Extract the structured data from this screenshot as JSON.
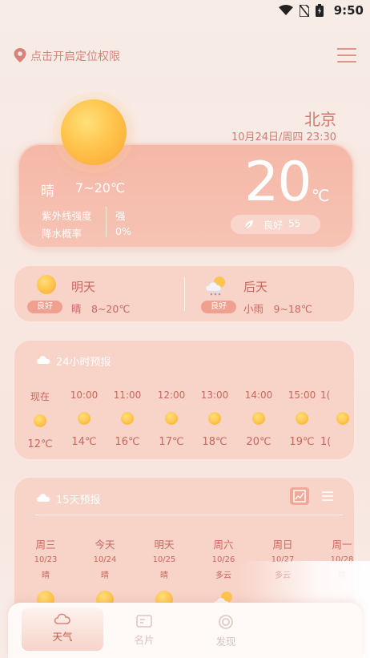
{
  "status": {
    "time": "9:50"
  },
  "header": {
    "location_prompt": "点击开启定位权限",
    "city": "北京",
    "datetime": "10月24日/周四 23:30"
  },
  "current": {
    "condition": "晴",
    "range": "7~20℃",
    "uv_label": "紫外线强度",
    "uv_value": "强",
    "rain_label": "降水概率",
    "rain_value": "0%",
    "temp": "20",
    "unit": "℃",
    "aq_label": "良好",
    "aq_value": "55"
  },
  "tomorrow": {
    "name": "明天",
    "badge": "良好",
    "detail": "晴　8~20℃"
  },
  "after_tomorrow": {
    "name": "后天",
    "badge": "良好",
    "detail": "小雨　9~18℃"
  },
  "hourly": {
    "title": "24小时预报",
    "items": [
      {
        "time": "现在",
        "temp": "12℃"
      },
      {
        "time": "10:00",
        "temp": "14℃"
      },
      {
        "time": "11:00",
        "temp": "16℃"
      },
      {
        "time": "12:00",
        "temp": "17℃"
      },
      {
        "time": "13:00",
        "temp": "18℃"
      },
      {
        "time": "14:00",
        "temp": "20℃"
      },
      {
        "time": "15:00",
        "temp": "19℃"
      },
      {
        "time": "1(",
        "temp": "1("
      }
    ]
  },
  "fifteen": {
    "title": "15天预报",
    "items": [
      {
        "name": "周三",
        "date": "10/23",
        "cond": "晴"
      },
      {
        "name": "今天",
        "date": "10/24",
        "cond": "晴"
      },
      {
        "name": "明天",
        "date": "10/25",
        "cond": "晴"
      },
      {
        "name": "周六",
        "date": "10/26",
        "cond": "多云"
      },
      {
        "name": "周日",
        "date": "10/27",
        "cond": "多云"
      },
      {
        "name": "周一",
        "date": "10/28",
        "cond": "晴"
      }
    ]
  },
  "nav": {
    "weather": "天气",
    "card": "名片",
    "discover": "发现"
  },
  "colors": {
    "accent": "#d9827a",
    "card": "#f8d3c8",
    "main_card": "#f5b8a8"
  }
}
